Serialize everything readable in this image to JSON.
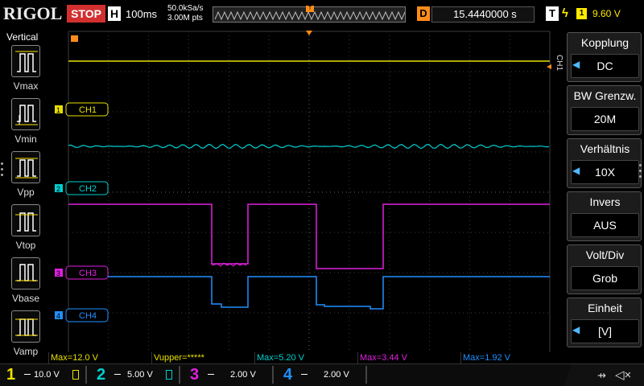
{
  "topbar": {
    "brand": "RIGOL",
    "run_state": "STOP",
    "horizontal_label": "H",
    "timebase": "100ms",
    "sample_rate": "50.0kSa/s",
    "memory_depth": "3.00M pts",
    "delay_label": "D",
    "delay_value": "15.4440000 s",
    "trigger_label": "T",
    "trigger_source": "1",
    "trigger_level": "9.60 V"
  },
  "left_panel": {
    "title": "Vertical",
    "items": [
      {
        "label": "Vmax",
        "icon": "vmax-icon"
      },
      {
        "label": "Vmin",
        "icon": "vmin-icon"
      },
      {
        "label": "Vpp",
        "icon": "vpp-icon"
      },
      {
        "label": "Vtop",
        "icon": "vtop-icon"
      },
      {
        "label": "Vbase",
        "icon": "vbase-icon"
      },
      {
        "label": "Vamp",
        "icon": "vamp-icon"
      }
    ]
  },
  "right_menu": {
    "side_label": "CH1",
    "items": [
      {
        "title": "Kopplung",
        "value": "DC",
        "arrow": true
      },
      {
        "title": "BW Grenzw.",
        "value": "20M",
        "arrow": false
      },
      {
        "title": "Verhältnis",
        "value": "10X",
        "arrow": true
      },
      {
        "title": "Invers",
        "value": "AUS",
        "arrow": false
      },
      {
        "title": "Volt/Div",
        "value": "Grob",
        "arrow": false
      },
      {
        "title": "Einheit",
        "value": "[V]",
        "arrow": true
      }
    ]
  },
  "channels": [
    {
      "id": "1",
      "tag": "CH1",
      "color": "#e8e000",
      "scale": "10.0 V"
    },
    {
      "id": "2",
      "tag": "CH2",
      "color": "#00d0d0",
      "scale": "5.00 V"
    },
    {
      "id": "3",
      "tag": "CH3",
      "color": "#e020e0",
      "scale": "2.00 V"
    },
    {
      "id": "4",
      "tag": "CH4",
      "color": "#2090ff",
      "scale": "2.00 V"
    }
  ],
  "measurements": [
    {
      "text": "Max=12.0 V",
      "color": "#e8e000"
    },
    {
      "text": "Vupper=*****",
      "color": "#e8e000"
    },
    {
      "text": "Max=5.20 V",
      "color": "#00d0d0"
    },
    {
      "text": "Max=3.44 V",
      "color": "#e020e0"
    },
    {
      "text": "Max=1.92 V",
      "color": "#2090ff"
    }
  ],
  "markers": {
    "trigger_pos_marker": "T"
  }
}
